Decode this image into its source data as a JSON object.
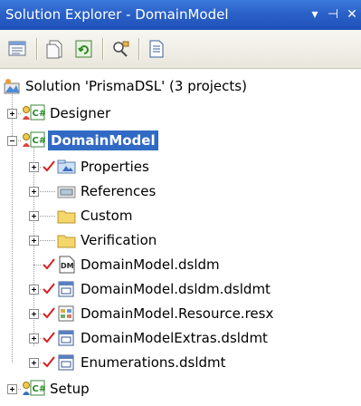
{
  "window": {
    "title": "Solution Explorer - DomainModel",
    "controls": {
      "dropdown": "▾",
      "pin": "⊣",
      "close": "✕"
    }
  },
  "toolbar": {
    "buttons": [
      {
        "name": "properties-icon"
      },
      {
        "name": "show-all-files-icon"
      },
      {
        "name": "refresh-icon"
      },
      {
        "name": "class-view-icon"
      },
      {
        "name": "view-code-icon"
      }
    ]
  },
  "tree": {
    "solution": {
      "label": "Solution 'PrismaDSL' (3 projects)",
      "icon": "solution-icon"
    },
    "projects": [
      {
        "label": "Designer",
        "icon": "csharp-project-icon",
        "expanded": false
      },
      {
        "label": "DomainModel",
        "icon": "csharp-project-icon",
        "expanded": true,
        "selected": true,
        "children": [
          {
            "label": "Properties",
            "icon": "properties-folder-icon",
            "checked": true,
            "expandable": true
          },
          {
            "label": "References",
            "icon": "references-icon",
            "checked": false,
            "expandable": true
          },
          {
            "label": "Custom",
            "icon": "folder-icon",
            "checked": false,
            "expandable": true
          },
          {
            "label": "Verification",
            "icon": "folder-icon",
            "checked": false,
            "expandable": true
          },
          {
            "label": "DomainModel.dsldm",
            "icon": "dm-file-icon",
            "checked": true,
            "expandable": false
          },
          {
            "label": "DomainModel.dsldm.dsldmt",
            "icon": "template-file-icon",
            "checked": true,
            "expandable": true
          },
          {
            "label": "DomainModel.Resource.resx",
            "icon": "resx-file-icon",
            "checked": true,
            "expandable": true
          },
          {
            "label": "DomainModelExtras.dsldmt",
            "icon": "template-file-icon",
            "checked": true,
            "expandable": true
          },
          {
            "label": "Enumerations.dsldmt",
            "icon": "template-file-icon",
            "checked": true,
            "expandable": true
          }
        ]
      },
      {
        "label": "Setup",
        "icon": "setup-project-icon",
        "expanded": false
      }
    ]
  },
  "colors": {
    "titlebar": "#2a61c8",
    "selection": "#316ac5",
    "checkmark": "#d42020"
  }
}
